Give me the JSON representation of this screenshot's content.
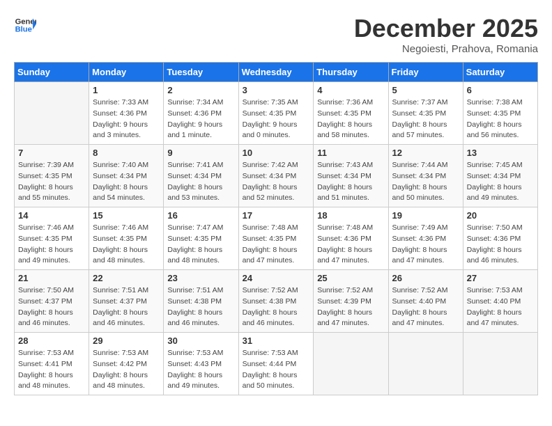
{
  "header": {
    "logo_line1": "General",
    "logo_line2": "Blue",
    "month_title": "December 2025",
    "subtitle": "Negoiesti, Prahova, Romania"
  },
  "weekdays": [
    "Sunday",
    "Monday",
    "Tuesday",
    "Wednesday",
    "Thursday",
    "Friday",
    "Saturday"
  ],
  "weeks": [
    [
      {
        "day": "",
        "info": ""
      },
      {
        "day": "1",
        "info": "Sunrise: 7:33 AM\nSunset: 4:36 PM\nDaylight: 9 hours\nand 3 minutes."
      },
      {
        "day": "2",
        "info": "Sunrise: 7:34 AM\nSunset: 4:36 PM\nDaylight: 9 hours\nand 1 minute."
      },
      {
        "day": "3",
        "info": "Sunrise: 7:35 AM\nSunset: 4:35 PM\nDaylight: 9 hours\nand 0 minutes."
      },
      {
        "day": "4",
        "info": "Sunrise: 7:36 AM\nSunset: 4:35 PM\nDaylight: 8 hours\nand 58 minutes."
      },
      {
        "day": "5",
        "info": "Sunrise: 7:37 AM\nSunset: 4:35 PM\nDaylight: 8 hours\nand 57 minutes."
      },
      {
        "day": "6",
        "info": "Sunrise: 7:38 AM\nSunset: 4:35 PM\nDaylight: 8 hours\nand 56 minutes."
      }
    ],
    [
      {
        "day": "7",
        "info": "Sunrise: 7:39 AM\nSunset: 4:35 PM\nDaylight: 8 hours\nand 55 minutes."
      },
      {
        "day": "8",
        "info": "Sunrise: 7:40 AM\nSunset: 4:34 PM\nDaylight: 8 hours\nand 54 minutes."
      },
      {
        "day": "9",
        "info": "Sunrise: 7:41 AM\nSunset: 4:34 PM\nDaylight: 8 hours\nand 53 minutes."
      },
      {
        "day": "10",
        "info": "Sunrise: 7:42 AM\nSunset: 4:34 PM\nDaylight: 8 hours\nand 52 minutes."
      },
      {
        "day": "11",
        "info": "Sunrise: 7:43 AM\nSunset: 4:34 PM\nDaylight: 8 hours\nand 51 minutes."
      },
      {
        "day": "12",
        "info": "Sunrise: 7:44 AM\nSunset: 4:34 PM\nDaylight: 8 hours\nand 50 minutes."
      },
      {
        "day": "13",
        "info": "Sunrise: 7:45 AM\nSunset: 4:34 PM\nDaylight: 8 hours\nand 49 minutes."
      }
    ],
    [
      {
        "day": "14",
        "info": "Sunrise: 7:46 AM\nSunset: 4:35 PM\nDaylight: 8 hours\nand 49 minutes."
      },
      {
        "day": "15",
        "info": "Sunrise: 7:46 AM\nSunset: 4:35 PM\nDaylight: 8 hours\nand 48 minutes."
      },
      {
        "day": "16",
        "info": "Sunrise: 7:47 AM\nSunset: 4:35 PM\nDaylight: 8 hours\nand 48 minutes."
      },
      {
        "day": "17",
        "info": "Sunrise: 7:48 AM\nSunset: 4:35 PM\nDaylight: 8 hours\nand 47 minutes."
      },
      {
        "day": "18",
        "info": "Sunrise: 7:48 AM\nSunset: 4:36 PM\nDaylight: 8 hours\nand 47 minutes."
      },
      {
        "day": "19",
        "info": "Sunrise: 7:49 AM\nSunset: 4:36 PM\nDaylight: 8 hours\nand 47 minutes."
      },
      {
        "day": "20",
        "info": "Sunrise: 7:50 AM\nSunset: 4:36 PM\nDaylight: 8 hours\nand 46 minutes."
      }
    ],
    [
      {
        "day": "21",
        "info": "Sunrise: 7:50 AM\nSunset: 4:37 PM\nDaylight: 8 hours\nand 46 minutes."
      },
      {
        "day": "22",
        "info": "Sunrise: 7:51 AM\nSunset: 4:37 PM\nDaylight: 8 hours\nand 46 minutes."
      },
      {
        "day": "23",
        "info": "Sunrise: 7:51 AM\nSunset: 4:38 PM\nDaylight: 8 hours\nand 46 minutes."
      },
      {
        "day": "24",
        "info": "Sunrise: 7:52 AM\nSunset: 4:38 PM\nDaylight: 8 hours\nand 46 minutes."
      },
      {
        "day": "25",
        "info": "Sunrise: 7:52 AM\nSunset: 4:39 PM\nDaylight: 8 hours\nand 47 minutes."
      },
      {
        "day": "26",
        "info": "Sunrise: 7:52 AM\nSunset: 4:40 PM\nDaylight: 8 hours\nand 47 minutes."
      },
      {
        "day": "27",
        "info": "Sunrise: 7:53 AM\nSunset: 4:40 PM\nDaylight: 8 hours\nand 47 minutes."
      }
    ],
    [
      {
        "day": "28",
        "info": "Sunrise: 7:53 AM\nSunset: 4:41 PM\nDaylight: 8 hours\nand 48 minutes."
      },
      {
        "day": "29",
        "info": "Sunrise: 7:53 AM\nSunset: 4:42 PM\nDaylight: 8 hours\nand 48 minutes."
      },
      {
        "day": "30",
        "info": "Sunrise: 7:53 AM\nSunset: 4:43 PM\nDaylight: 8 hours\nand 49 minutes."
      },
      {
        "day": "31",
        "info": "Sunrise: 7:53 AM\nSunset: 4:44 PM\nDaylight: 8 hours\nand 50 minutes."
      },
      {
        "day": "",
        "info": ""
      },
      {
        "day": "",
        "info": ""
      },
      {
        "day": "",
        "info": ""
      }
    ]
  ]
}
